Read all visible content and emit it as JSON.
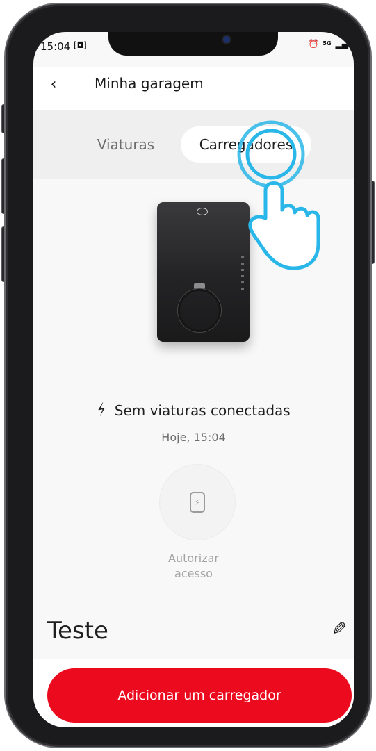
{
  "status_bar": {
    "time": "15:04",
    "screenshot_glyph": "[◘]",
    "alarm_icon": "alarm-icon",
    "network": "5G",
    "signal_icon": "signal-icon"
  },
  "header": {
    "back_glyph": "‹",
    "title": "Minha garagem"
  },
  "tabs": [
    {
      "label": "Viaturas",
      "selected": false
    },
    {
      "label": "Carregadores",
      "selected": true
    }
  ],
  "charger": {
    "image": "charger-device-image",
    "status_glyph": "⚡",
    "status_text": "Sem viaturas conectadas",
    "timestamp": "Hoje, 15:04",
    "name": "Teste",
    "edit_glyph": "✎"
  },
  "authorize": {
    "icon": "phone-charge-icon",
    "glyph": "⚡",
    "label_line1": "Autorizar",
    "label_line2": "acesso"
  },
  "bottom": {
    "add_button": "Adicionar um carregador"
  },
  "colors": {
    "accent": "#eb0a1e",
    "tap_hint": "#29b6e8",
    "tab_band": "#efefef"
  }
}
